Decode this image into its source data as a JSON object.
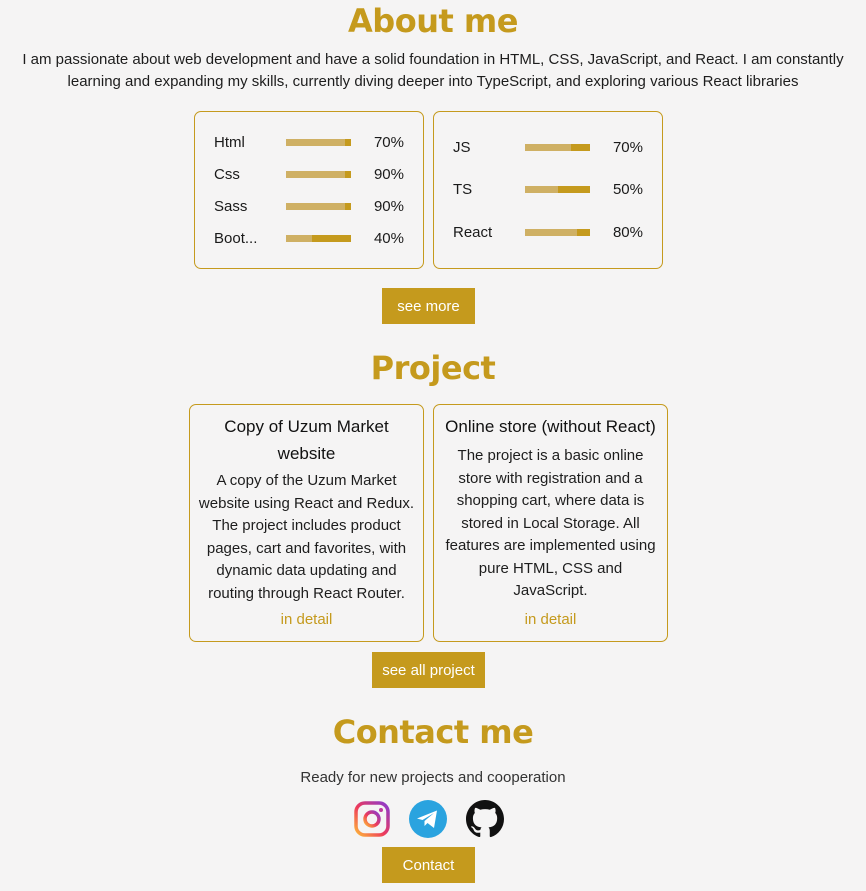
{
  "about": {
    "title": "About me",
    "text": "I am passionate about web development and have a solid foundation in HTML, CSS, JavaScript, and React. I am constantly learning and expanding my skills, currently diving deeper into TypeScript, and exploring various React libraries"
  },
  "skills_left": [
    {
      "name": "Html",
      "percent": "70%",
      "level": 0.9
    },
    {
      "name": "Css",
      "percent": "90%",
      "level": 0.9
    },
    {
      "name": "Sass",
      "percent": "90%",
      "level": 0.9
    },
    {
      "name": "Boot...",
      "percent": "40%",
      "level": 0.4
    }
  ],
  "skills_right": [
    {
      "name": "JS",
      "percent": "70%",
      "level": 0.7
    },
    {
      "name": "TS",
      "percent": "50%",
      "level": 0.5
    },
    {
      "name": "React",
      "percent": "80%",
      "level": 0.8
    }
  ],
  "buttons": {
    "see_more": "see more",
    "see_all": "see all project",
    "contact": "Contact"
  },
  "project": {
    "title": "Project",
    "items": [
      {
        "name": "Copy of Uzum Market website",
        "description": "A copy of the Uzum Market website using React and Redux. The project includes product pages, cart and favorites, with dynamic data updating and routing through React Router.",
        "link": "in detail"
      },
      {
        "name": "Online store (without React)",
        "description": "The project is a basic online store with registration and a shopping cart, where data is stored in Local Storage. All features are implemented using pure HTML, CSS and JavaScript.",
        "link": "in detail"
      }
    ]
  },
  "contact": {
    "title": "Contact me",
    "text": "Ready for new projects and cooperation"
  },
  "social_icons": [
    "instagram-icon",
    "telegram-icon",
    "github-icon"
  ],
  "colors": {
    "accent": "#c59a1d",
    "bar_light": "#cfb064",
    "background": "#f5f4f4"
  }
}
